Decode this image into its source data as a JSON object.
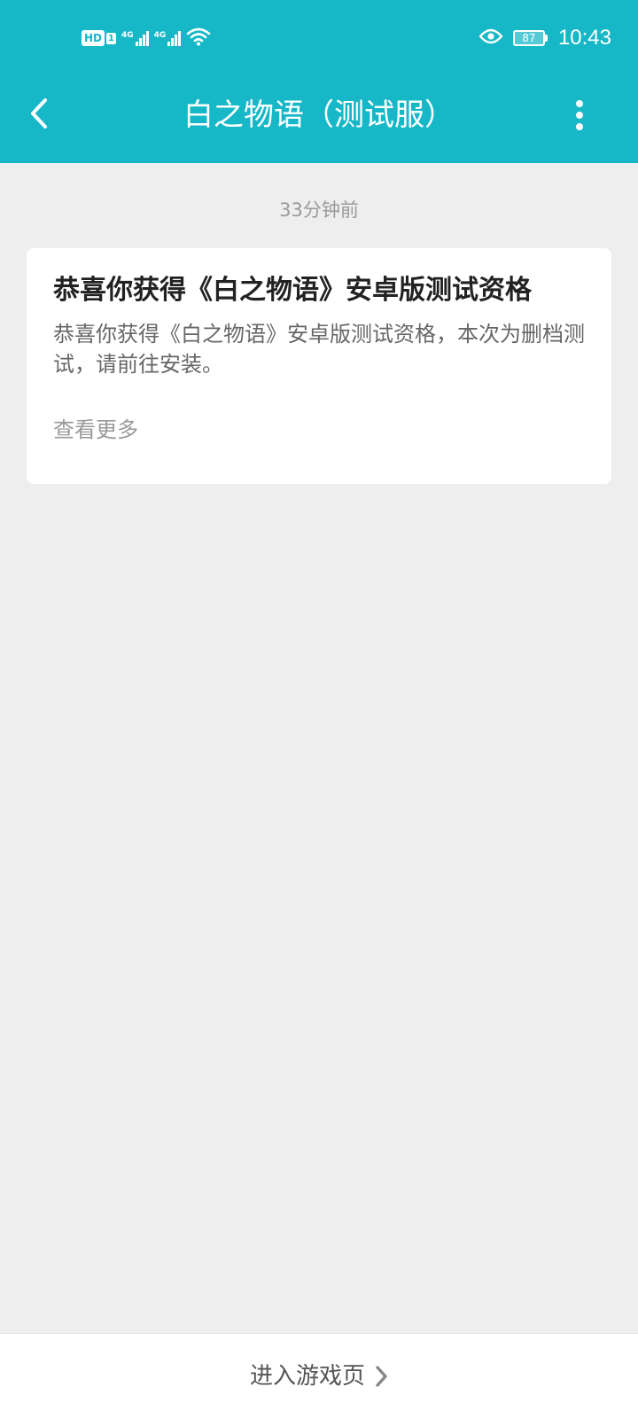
{
  "status_bar": {
    "hd_label": "HD",
    "sim_number": "1",
    "network_1": "4G",
    "network_2": "4G",
    "battery_level": "87",
    "time": "10:43",
    "icons": [
      "wifi-icon",
      "eye-icon",
      "battery-icon"
    ]
  },
  "app_bar": {
    "title": "白之物语（测试服）",
    "back_icon": "chevron-left-icon",
    "more_icon": "more-vertical-icon"
  },
  "message": {
    "timestamp": "33分钟前",
    "title": "恭喜你获得《白之物语》安卓版测试资格",
    "body": "恭喜你获得《白之物语》安卓版测试资格，本次为删档测试，请前往安装。",
    "more_label": "查看更多"
  },
  "footer": {
    "label": "进入游戏页",
    "icon": "chevron-right-icon"
  },
  "colors": {
    "primary": "#16b8c8",
    "background": "#eeeeee",
    "card": "#ffffff"
  }
}
